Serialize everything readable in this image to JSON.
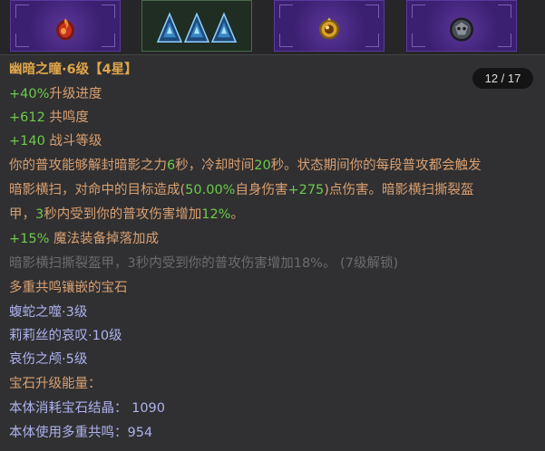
{
  "item": {
    "title": "幽暗之瞳·6级【4星】",
    "page_indicator": "12 / 17",
    "upgrade_progress": {
      "value": "+40%",
      "label": "升级进度"
    },
    "resonance": {
      "value": "+612",
      "label": " 共鸣度"
    },
    "combat_level": {
      "value": "+140",
      "label": " 战斗等级"
    },
    "ability": {
      "l1_a": "你的普攻能够解封暗影之力",
      "l1_b": "6",
      "l1_c": "秒，冷却时间",
      "l1_d": "20",
      "l1_e": "秒。状态期间你的每段普攻都会触发",
      "l2_a": "暗影横扫，对命中的目标造成(",
      "l2_b": "50.00%",
      "l2_c": "自身伤害",
      "l2_d": "+275",
      "l2_e": ")点伤害。暗影横扫撕裂盔",
      "l3_a": "甲，",
      "l3_b": "3",
      "l3_c": "秒内受到你的普攻伤害增加",
      "l3_d": "12%",
      "l3_e": "。"
    },
    "magic_drop": {
      "value": "+15%",
      "label": " 魔法装备掉落加成"
    },
    "locked_effect": "暗影横扫撕裂盔甲，3秒内受到你的普攻伤害增加18%。 (7级解锁)",
    "multi_resonance_header": "多重共鸣镶嵌的宝石",
    "gems": [
      "蝮蛇之噬·3级",
      "莉莉丝的哀叹·10级",
      "哀伤之颅·5级"
    ],
    "upgrade_energy_header": "宝石升级能量：",
    "consume_crystal": "本体消耗宝石结晶： 1090",
    "use_resonance": "本体使用多重共鸣：954"
  },
  "icons": {
    "slot1": "red-fire-gem-icon",
    "slot2": "blue-triangle-gems-icon",
    "slot3": "gold-amber-gem-icon",
    "slot4": "dark-skull-gem-icon"
  },
  "colors": {
    "title": "#e0a64a",
    "orange_text": "#d9a070",
    "green_value": "#6dca4a",
    "locked_text": "#6c6c70",
    "gem_name": "#aeb2ee",
    "panel_bg": "#303032",
    "slot_purple": "#3b1f70"
  }
}
